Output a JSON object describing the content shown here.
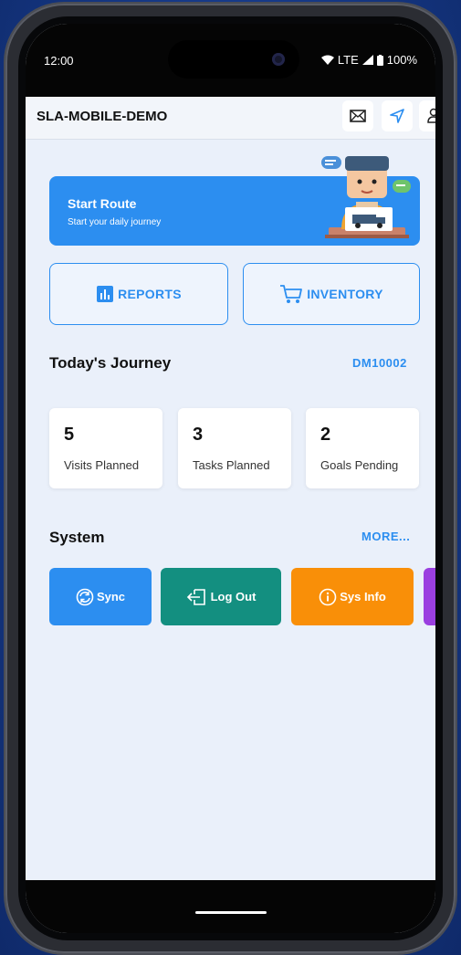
{
  "status": {
    "time": "12:00",
    "network": "LTE",
    "battery": "100%"
  },
  "appbar": {
    "title": "SLA-MOBILE-DEMO"
  },
  "route": {
    "title": "Start Route",
    "subtitle": "Start your daily journey"
  },
  "actions": {
    "reports": "REPORTS",
    "inventory": "INVENTORY"
  },
  "journey": {
    "title": "Today's Journey",
    "code": "DM10002",
    "stats": [
      {
        "value": "5",
        "label": "Visits Planned"
      },
      {
        "value": "3",
        "label": "Tasks Planned"
      },
      {
        "value": "2",
        "label": "Goals Pending"
      }
    ]
  },
  "system": {
    "title": "System",
    "more": "MORE...",
    "buttons": [
      {
        "label": "Sync",
        "icon": "sync-icon",
        "color": "#2c8ef0"
      },
      {
        "label": "Log Out",
        "icon": "logout-icon",
        "color": "#138f80"
      },
      {
        "label": "Sys Info",
        "icon": "info-icon",
        "color": "#f98f08"
      },
      {
        "label": "",
        "icon": "",
        "color": "#9a3fe0"
      }
    ]
  },
  "colors": {
    "primary": "#2c8ef0",
    "background": "#eaf0fa"
  }
}
